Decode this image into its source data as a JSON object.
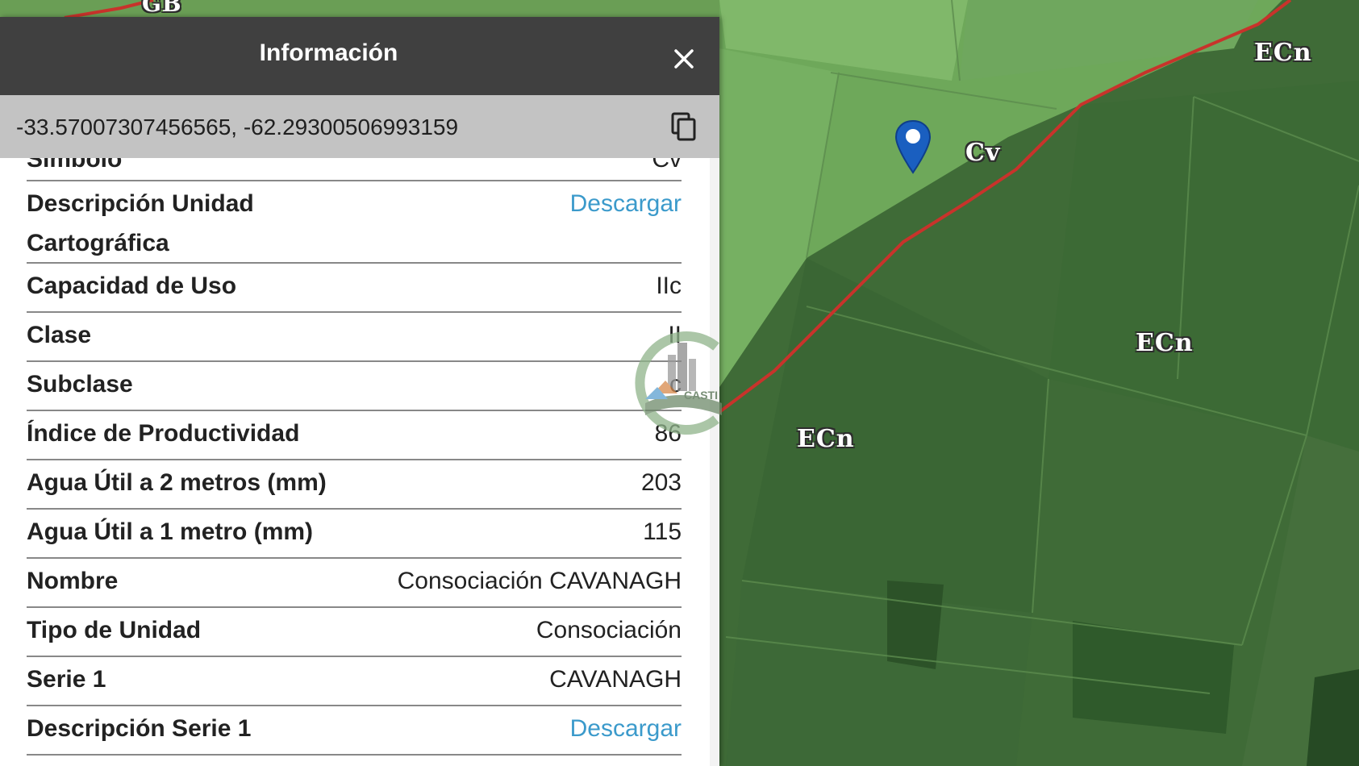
{
  "map": {
    "labels": [
      "ECn",
      "Cv",
      "ECn",
      "ECn",
      "GB"
    ],
    "pin_icon": "map-pin-icon",
    "pin_color": "#1a5fc0",
    "boundary_color": "#c8332b"
  },
  "panel": {
    "title": "Información",
    "close_icon": "close-icon",
    "coordinates": "-33.57007307456565, -62.29300506993159",
    "copy_icon": "copy-icon",
    "header_color": "#404040",
    "coord_bar_color": "#c3c3c3",
    "link_color": "#3b9acb",
    "partial_row": {
      "label": "Símbolo",
      "value": "Cv"
    },
    "rows": [
      {
        "label": "Descripción Unidad",
        "label2": "Cartográfica",
        "value": "Descargar"
      },
      {
        "label": "Capacidad de Uso",
        "value": "IIc"
      },
      {
        "label": "Clase",
        "value": "II"
      },
      {
        "label": "Subclase",
        "value": "c"
      },
      {
        "label": "Índice de Productividad",
        "value": "86"
      },
      {
        "label": "Agua Útil a 2 metros (mm)",
        "value": "203"
      },
      {
        "label": "Agua Útil a 1 metro (mm)",
        "value": "115"
      },
      {
        "label": "Nombre",
        "value": "Consociación CAVANAGH"
      },
      {
        "label": "Tipo de Unidad",
        "value": "Consociación"
      },
      {
        "label": "Serie 1",
        "value": "CAVANAGH"
      },
      {
        "label": "Descripción Serie 1",
        "value": "Descargar"
      }
    ]
  },
  "watermark": {
    "text": "CASTI"
  }
}
